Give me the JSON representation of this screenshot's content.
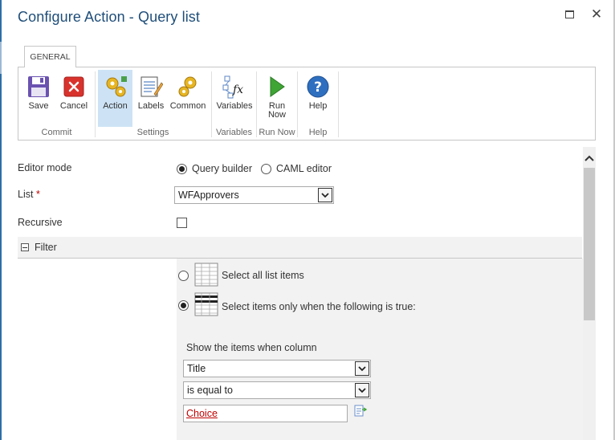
{
  "dialog": {
    "title": "Configure Action - Query list"
  },
  "ribbon": {
    "tab": "GENERAL",
    "groups": [
      {
        "label": "Commit",
        "buttons": [
          {
            "label": "Save",
            "icon": "save-icon"
          },
          {
            "label": "Cancel",
            "icon": "cancel-icon"
          }
        ]
      },
      {
        "label": "Settings",
        "buttons": [
          {
            "label": "Action",
            "icon": "action-gears-icon",
            "selected": true
          },
          {
            "label": "Labels",
            "icon": "labels-icon"
          },
          {
            "label": "Common",
            "icon": "common-gears-icon"
          }
        ]
      },
      {
        "label": "Variables",
        "buttons": [
          {
            "label": "Variables",
            "icon": "variables-fx-icon"
          }
        ]
      },
      {
        "label": "Run Now",
        "buttons": [
          {
            "label": "Run\nNow",
            "icon": "play-icon"
          }
        ]
      },
      {
        "label": "Help",
        "buttons": [
          {
            "label": "Help",
            "icon": "help-icon"
          }
        ]
      }
    ]
  },
  "form": {
    "editor_mode": {
      "label": "Editor mode",
      "options": [
        "Query builder",
        "CAML editor"
      ],
      "selected": "Query builder"
    },
    "list": {
      "label": "List",
      "required_marker": "*",
      "value": "WFApprovers"
    },
    "recursive": {
      "label": "Recursive",
      "checked": false
    }
  },
  "filter": {
    "title": "Filter",
    "select_all_label": "Select all list items",
    "select_when_label": "Select items only when the following is true:",
    "selected_option": "when",
    "show_items_label": "Show the items when column",
    "column_value": "Title",
    "operator_value": "is equal to",
    "match_value": "Choice"
  },
  "colors": {
    "title": "#1f4e79",
    "accent_blue": "#2d6ea8",
    "required": "#c00000",
    "selected_button": "#cde3f5",
    "panel_gray": "#f2f2f2"
  }
}
